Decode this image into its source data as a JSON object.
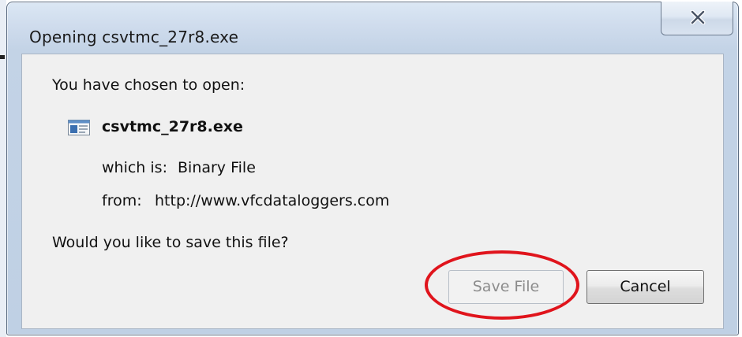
{
  "window": {
    "title": "Opening csvtmc_27r8.exe"
  },
  "dialog": {
    "intro": "You have chosen to open:",
    "file_name": "csvtmc_27r8.exe",
    "type_label": "which is:",
    "type_value": "Binary File",
    "source_label": "from:",
    "source_value": "http://www.vfcdataloggers.com",
    "question": "Would you like to save this file?"
  },
  "buttons": {
    "save_label": "Save File",
    "cancel_label": "Cancel"
  },
  "icons": {
    "close": "close-icon",
    "file": "executable-file-icon"
  },
  "colors": {
    "highlight": "#e0141c",
    "title_bar": "#cfdced",
    "client": "#f0f0f0"
  }
}
